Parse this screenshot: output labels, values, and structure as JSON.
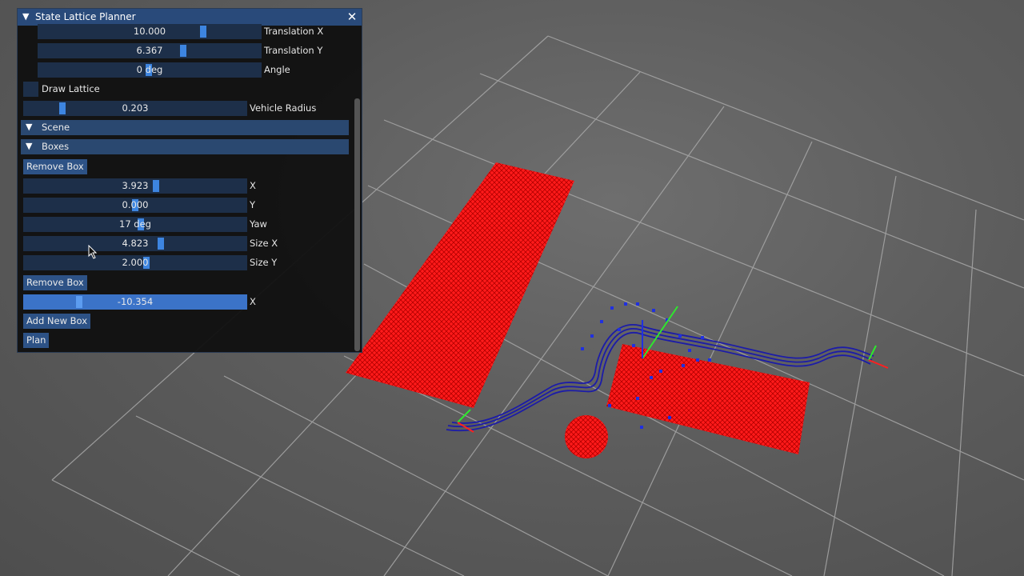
{
  "window": {
    "title": "State Lattice Planner"
  },
  "lattice": {
    "translation_x": {
      "value": "10.000",
      "label": "Translation X"
    },
    "translation_y": {
      "value": "6.367",
      "label": "Translation Y"
    },
    "angle": {
      "value": "0 deg",
      "label": "Angle"
    },
    "draw_lattice_label": "Draw Lattice",
    "vehicle_radius": {
      "value": "0.203",
      "label": "Vehicle Radius"
    }
  },
  "sections": {
    "scene": "Scene",
    "boxes": "Boxes"
  },
  "boxes": [
    {
      "remove_label": "Remove Box",
      "x": {
        "value": "3.923",
        "label": "X"
      },
      "y": {
        "value": "0.000",
        "label": "Y"
      },
      "yaw": {
        "value": "17 deg",
        "label": "Yaw"
      },
      "size_x": {
        "value": "4.823",
        "label": "Size X"
      },
      "size_y": {
        "value": "2.000",
        "label": "Size Y"
      }
    },
    {
      "remove_label": "Remove Box",
      "x": {
        "value": "-10.354",
        "label": "X"
      }
    }
  ],
  "actions": {
    "add_new_box": "Add New Box",
    "plan": "Plan"
  },
  "colors": {
    "title_bar": "#294a7a",
    "slider_bg": "#1d2f49",
    "slider_grab": "#3d85e0",
    "button": "#2d5286",
    "obstacle": "#ff0000",
    "path": "#1c1ca8",
    "grid_line": "#a0a0a0"
  }
}
